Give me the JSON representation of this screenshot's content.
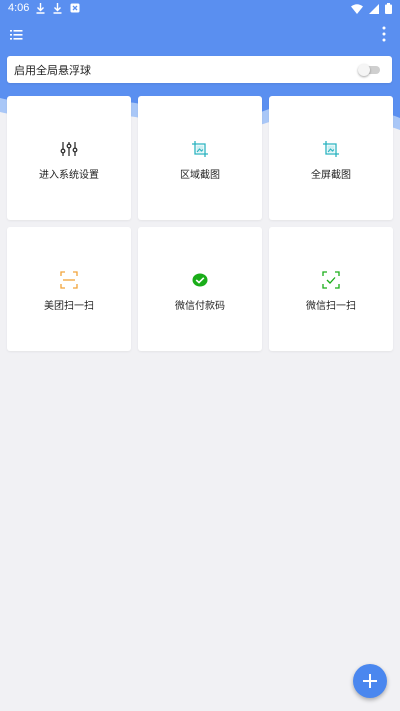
{
  "status_bar": {
    "time": "4:06",
    "left_icons": [
      "download-icon",
      "download-icon",
      "app-notification-icon"
    ],
    "right_icons": [
      "wifi-icon",
      "signal-icon",
      "battery-icon"
    ]
  },
  "toolbar": {
    "menu_icon": "list-menu-icon",
    "more_icon": "more-vert-icon"
  },
  "floating_ball": {
    "label": "启用全局悬浮球",
    "enabled": false
  },
  "tiles": [
    {
      "label": "进入系统设置",
      "icon": "sliders-icon",
      "color": "#333333"
    },
    {
      "label": "区域截图",
      "icon": "crop-screenshot-icon",
      "color": "#2bb3c0"
    },
    {
      "label": "全屏截图",
      "icon": "fullscreen-screenshot-icon",
      "color": "#2bb3c0"
    },
    {
      "label": "美团扫一扫",
      "icon": "scan-frame-icon",
      "color": "#f2a33a"
    },
    {
      "label": "微信付款码",
      "icon": "wechat-pay-icon",
      "color": "#1aad19"
    },
    {
      "label": "微信扫一扫",
      "icon": "wechat-scan-icon",
      "color": "#1aad19"
    }
  ],
  "fab": {
    "icon": "plus-icon"
  },
  "colors": {
    "primary": "#5a8ff0",
    "primary_light": "#a9c7f7",
    "background": "#f1f1f4",
    "fab": "#4a87ef"
  }
}
